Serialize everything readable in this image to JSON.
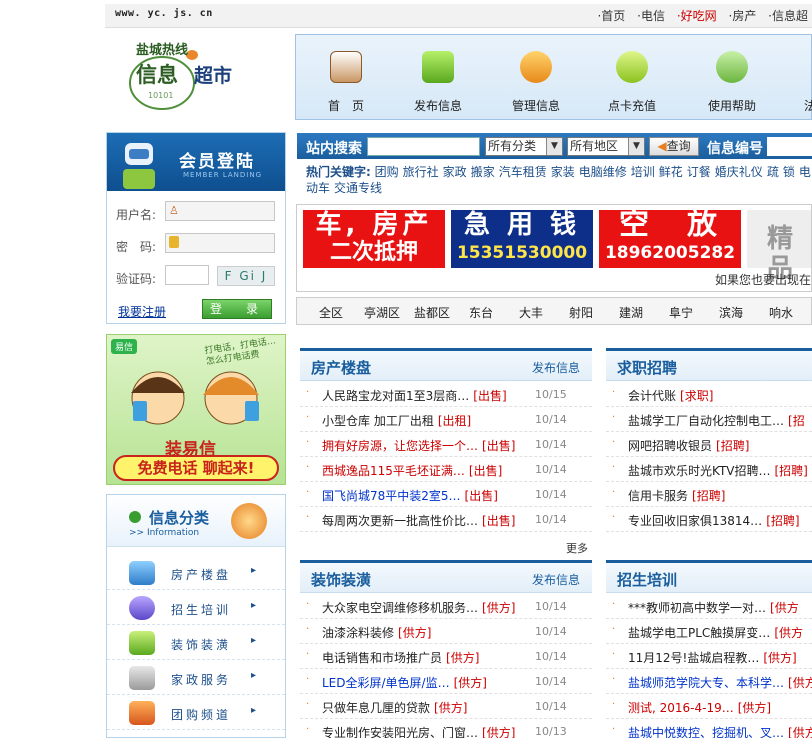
{
  "topbar": {
    "url": "www. yc. js. cn",
    "links": [
      "首页",
      "电信",
      "好吃网",
      "房产",
      "信息超"
    ]
  },
  "logo": {
    "line1": "盐城热线",
    "line2": "信息",
    "line3": "超市",
    "sub": "10101"
  },
  "mainnav": [
    "首　页",
    "发布信息",
    "管理信息",
    "点卡充值",
    "使用帮助",
    "法"
  ],
  "login": {
    "title": "会员登陆",
    "subtitle": "MEMBER LANDING",
    "username_label": "用户名:",
    "password_label": "密　码:",
    "captcha_label": "验证码:",
    "captcha_code": "F Gi J",
    "register": "我要注册",
    "submit": "登　录"
  },
  "ad_yixin": {
    "brand": "易信",
    "bubble": "打电话，打电话…怎么打电话费",
    "line1": "装易信",
    "line2": "免费电话 聊起来!"
  },
  "categories": {
    "title": "信息分类",
    "subtitle": ">> Information",
    "items": [
      "房产楼盘",
      "招生培训",
      "装饰装潢",
      "家政服务",
      "团购频道"
    ]
  },
  "search": {
    "label": "站内搜索",
    "category_select": "所有分类",
    "region_select": "所有地区",
    "query_button": "查询",
    "info_no_label": "信息编号",
    "hot_label": "热门关键字:",
    "hot_keywords": [
      "团购",
      "旅行社",
      "家政",
      "搬家",
      "汽车租赁",
      "家装",
      "电脑维修",
      "培训",
      "鲜花",
      "订餐",
      "婚庆礼仪",
      "疏",
      "锁",
      "电动车",
      "交通专线"
    ]
  },
  "banners": [
    {
      "line1": "车, 房产",
      "line2": "二次抵押"
    },
    {
      "line1": "急 用 钱",
      "line2": "15351530000"
    },
    {
      "line1": "空　放",
      "line2": "18962005282"
    },
    {
      "line1": "精 品",
      "line2": ""
    }
  ],
  "marquee": "如果您也要出现在",
  "districts": [
    "全区",
    "亭湖区",
    "盐都区",
    "东台",
    "大丰",
    "射阳",
    "建湖",
    "阜宁",
    "滨海",
    "响水"
  ],
  "panels": {
    "house": {
      "title": "房产楼盘",
      "more": "发布信息",
      "rows": [
        {
          "text": "人民路宝龙对面1至3层商…",
          "tag": "[出售]",
          "date": "10/15",
          "color": "#222"
        },
        {
          "text": "小型仓库 加工厂出租",
          "tag": "[出租]",
          "date": "10/14",
          "color": "#222"
        },
        {
          "text": "拥有好房源，让您选择一个…",
          "tag": "[出售]",
          "date": "10/14",
          "color": "#c00"
        },
        {
          "text": "西城逸品115平毛坯证满…",
          "tag": "[出售]",
          "date": "10/14",
          "color": "#c00"
        },
        {
          "text": "国飞尚城78平中装2室5…",
          "tag": "[出售]",
          "date": "10/14",
          "color": "#0033cc"
        },
        {
          "text": "每周两次更新一批高性价比…",
          "tag": "[出售]",
          "date": "10/14",
          "color": "#222"
        }
      ],
      "more_link": "更多"
    },
    "jobs": {
      "title": "求职招聘",
      "rows": [
        {
          "text": "会计代账",
          "tag": "[求职]",
          "color": "#222"
        },
        {
          "text": "盐城学工厂自动化控制电工…",
          "tag": "[招",
          "color": "#222"
        },
        {
          "text": "网吧招聘收银员",
          "tag": "[招聘]",
          "color": "#222"
        },
        {
          "text": "盐城市欢乐时光KTV招聘…",
          "tag": "[招聘]",
          "color": "#222"
        },
        {
          "text": "信用卡服务",
          "tag": "[招聘]",
          "color": "#222"
        },
        {
          "text": "专业回收旧家俱13814…",
          "tag": "[招聘]",
          "color": "#222"
        }
      ]
    },
    "decor": {
      "title": "装饰装潢",
      "more": "发布信息",
      "rows": [
        {
          "text": "大众家电空调维修移机服务…",
          "tag": "[供方]",
          "date": "10/14",
          "color": "#222"
        },
        {
          "text": "油漆涂料装修",
          "tag": "[供方]",
          "date": "10/14",
          "color": "#222"
        },
        {
          "text": "电话销售和市场推广员",
          "tag": "[供方]",
          "date": "10/14",
          "color": "#222"
        },
        {
          "text": "LED全彩屏/单色屏/监…",
          "tag": "[供方]",
          "date": "10/14",
          "color": "#0033cc"
        },
        {
          "text": "只做年息几厘的贷款",
          "tag": "[供方]",
          "date": "10/14",
          "color": "#222"
        },
        {
          "text": "专业制作安装阳光房、门窗…",
          "tag": "[供方]",
          "date": "10/13",
          "color": "#222"
        }
      ]
    },
    "edu": {
      "title": "招生培训",
      "rows": [
        {
          "text": "***教师初高中数学一对…",
          "tag": "[供方",
          "color": "#222"
        },
        {
          "text": "盐城学电工PLC触摸屏变…",
          "tag": "[供方",
          "color": "#222"
        },
        {
          "text": "11月12号!盐城启程教…",
          "tag": "[供方]",
          "color": "#222"
        },
        {
          "text": "盐城师范学院大专、本科学…",
          "tag": "[供方",
          "color": "#0033cc"
        },
        {
          "text": "测试, 2016-4-19…",
          "tag": "[供方]",
          "color": "#c00"
        },
        {
          "text": "盐城中悦数控、挖掘机、叉…",
          "tag": "[供方",
          "color": "#0033cc"
        }
      ]
    }
  },
  "colors": {
    "brand_blue": "#1a5e9e",
    "tag_red": "#cc0000",
    "accent_green": "#3a9d2f"
  }
}
